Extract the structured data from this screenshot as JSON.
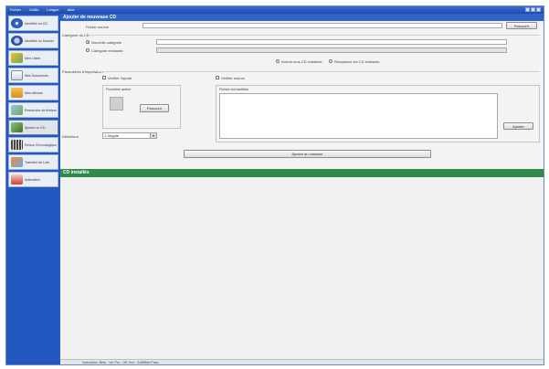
{
  "window": {
    "menu": [
      "Fichier",
      "Outils",
      "Langue",
      "Aide"
    ]
  },
  "sidebar": {
    "items": [
      {
        "label": "Identifier un CD",
        "icon": "disc-icon"
      },
      {
        "label": "Identifier un Dossier",
        "icon": "magnifier-icon"
      },
      {
        "label": "Mes Listes",
        "icon": "pencil-icon"
      },
      {
        "label": "Mes Documents",
        "icon": "document-icon"
      },
      {
        "label": "Mes Albums",
        "icon": "folder-icon"
      },
      {
        "label": "Recherche de fichiers",
        "icon": "search-files-icon"
      },
      {
        "label": "Ajouter un CD",
        "icon": "add-cd-icon"
      },
      {
        "label": "Retour Chronologique",
        "icon": "timeline-icon"
      },
      {
        "label": "Transfert de Lots",
        "icon": "transfer-icon"
      },
      {
        "label": "Indexation",
        "icon": "indexation-icon"
      }
    ],
    "selected_index": 6,
    "colors": {
      "background": "#2358c0"
    }
  },
  "form": {
    "header": "Ajouter de nouveaux CD",
    "source_label": "Fichier source",
    "browse_label": "Parcourir",
    "category_section": "Catégorie du CD",
    "new_category_label": "Nouvelle catégorie",
    "existing_category_label": "Catégorie existante",
    "include_all_label": "Inclure tous CD existants",
    "replace_all_label": "Remplacer les CD existants",
    "params_section": "Paramètres d'importation",
    "cover_checkbox_label": "Vérifier l'ajouté",
    "source_checkbox_label": "Vérifier source",
    "cover_group_label": "Pochette active",
    "cover_browse_label": "Parcourir",
    "sample_group_label": "Fichier échantillon",
    "sample_browse_label": "Ajouter",
    "separator_label": "Délimiteur",
    "separator_value": "1-Virgule",
    "submit_label": "Ajouter au classeur"
  },
  "results": {
    "header": "CD installés",
    "colors": {
      "background": "#2f8a4c"
    }
  },
  "status": {
    "text": "Indexation: Beta - Ver Pro - Off-Text - SoftBible Pass"
  }
}
